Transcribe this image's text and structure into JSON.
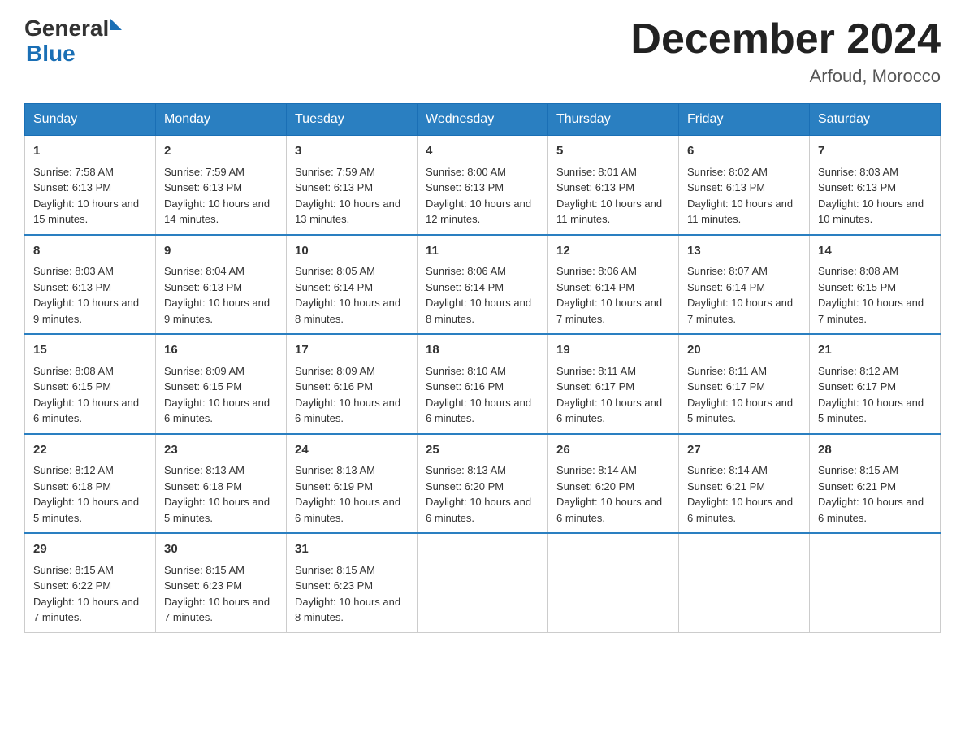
{
  "header": {
    "logo_general": "General",
    "logo_blue": "Blue",
    "title": "December 2024",
    "subtitle": "Arfoud, Morocco"
  },
  "days_of_week": [
    "Sunday",
    "Monday",
    "Tuesday",
    "Wednesday",
    "Thursday",
    "Friday",
    "Saturday"
  ],
  "weeks": [
    [
      {
        "day": "1",
        "sunrise": "7:58 AM",
        "sunset": "6:13 PM",
        "daylight": "10 hours and 15 minutes."
      },
      {
        "day": "2",
        "sunrise": "7:59 AM",
        "sunset": "6:13 PM",
        "daylight": "10 hours and 14 minutes."
      },
      {
        "day": "3",
        "sunrise": "7:59 AM",
        "sunset": "6:13 PM",
        "daylight": "10 hours and 13 minutes."
      },
      {
        "day": "4",
        "sunrise": "8:00 AM",
        "sunset": "6:13 PM",
        "daylight": "10 hours and 12 minutes."
      },
      {
        "day": "5",
        "sunrise": "8:01 AM",
        "sunset": "6:13 PM",
        "daylight": "10 hours and 11 minutes."
      },
      {
        "day": "6",
        "sunrise": "8:02 AM",
        "sunset": "6:13 PM",
        "daylight": "10 hours and 11 minutes."
      },
      {
        "day": "7",
        "sunrise": "8:03 AM",
        "sunset": "6:13 PM",
        "daylight": "10 hours and 10 minutes."
      }
    ],
    [
      {
        "day": "8",
        "sunrise": "8:03 AM",
        "sunset": "6:13 PM",
        "daylight": "10 hours and 9 minutes."
      },
      {
        "day": "9",
        "sunrise": "8:04 AM",
        "sunset": "6:13 PM",
        "daylight": "10 hours and 9 minutes."
      },
      {
        "day": "10",
        "sunrise": "8:05 AM",
        "sunset": "6:14 PM",
        "daylight": "10 hours and 8 minutes."
      },
      {
        "day": "11",
        "sunrise": "8:06 AM",
        "sunset": "6:14 PM",
        "daylight": "10 hours and 8 minutes."
      },
      {
        "day": "12",
        "sunrise": "8:06 AM",
        "sunset": "6:14 PM",
        "daylight": "10 hours and 7 minutes."
      },
      {
        "day": "13",
        "sunrise": "8:07 AM",
        "sunset": "6:14 PM",
        "daylight": "10 hours and 7 minutes."
      },
      {
        "day": "14",
        "sunrise": "8:08 AM",
        "sunset": "6:15 PM",
        "daylight": "10 hours and 7 minutes."
      }
    ],
    [
      {
        "day": "15",
        "sunrise": "8:08 AM",
        "sunset": "6:15 PM",
        "daylight": "10 hours and 6 minutes."
      },
      {
        "day": "16",
        "sunrise": "8:09 AM",
        "sunset": "6:15 PM",
        "daylight": "10 hours and 6 minutes."
      },
      {
        "day": "17",
        "sunrise": "8:09 AM",
        "sunset": "6:16 PM",
        "daylight": "10 hours and 6 minutes."
      },
      {
        "day": "18",
        "sunrise": "8:10 AM",
        "sunset": "6:16 PM",
        "daylight": "10 hours and 6 minutes."
      },
      {
        "day": "19",
        "sunrise": "8:11 AM",
        "sunset": "6:17 PM",
        "daylight": "10 hours and 6 minutes."
      },
      {
        "day": "20",
        "sunrise": "8:11 AM",
        "sunset": "6:17 PM",
        "daylight": "10 hours and 5 minutes."
      },
      {
        "day": "21",
        "sunrise": "8:12 AM",
        "sunset": "6:17 PM",
        "daylight": "10 hours and 5 minutes."
      }
    ],
    [
      {
        "day": "22",
        "sunrise": "8:12 AM",
        "sunset": "6:18 PM",
        "daylight": "10 hours and 5 minutes."
      },
      {
        "day": "23",
        "sunrise": "8:13 AM",
        "sunset": "6:18 PM",
        "daylight": "10 hours and 5 minutes."
      },
      {
        "day": "24",
        "sunrise": "8:13 AM",
        "sunset": "6:19 PM",
        "daylight": "10 hours and 6 minutes."
      },
      {
        "day": "25",
        "sunrise": "8:13 AM",
        "sunset": "6:20 PM",
        "daylight": "10 hours and 6 minutes."
      },
      {
        "day": "26",
        "sunrise": "8:14 AM",
        "sunset": "6:20 PM",
        "daylight": "10 hours and 6 minutes."
      },
      {
        "day": "27",
        "sunrise": "8:14 AM",
        "sunset": "6:21 PM",
        "daylight": "10 hours and 6 minutes."
      },
      {
        "day": "28",
        "sunrise": "8:15 AM",
        "sunset": "6:21 PM",
        "daylight": "10 hours and 6 minutes."
      }
    ],
    [
      {
        "day": "29",
        "sunrise": "8:15 AM",
        "sunset": "6:22 PM",
        "daylight": "10 hours and 7 minutes."
      },
      {
        "day": "30",
        "sunrise": "8:15 AM",
        "sunset": "6:23 PM",
        "daylight": "10 hours and 7 minutes."
      },
      {
        "day": "31",
        "sunrise": "8:15 AM",
        "sunset": "6:23 PM",
        "daylight": "10 hours and 8 minutes."
      },
      null,
      null,
      null,
      null
    ]
  ],
  "labels": {
    "sunrise": "Sunrise:",
    "sunset": "Sunset:",
    "daylight": "Daylight:"
  }
}
